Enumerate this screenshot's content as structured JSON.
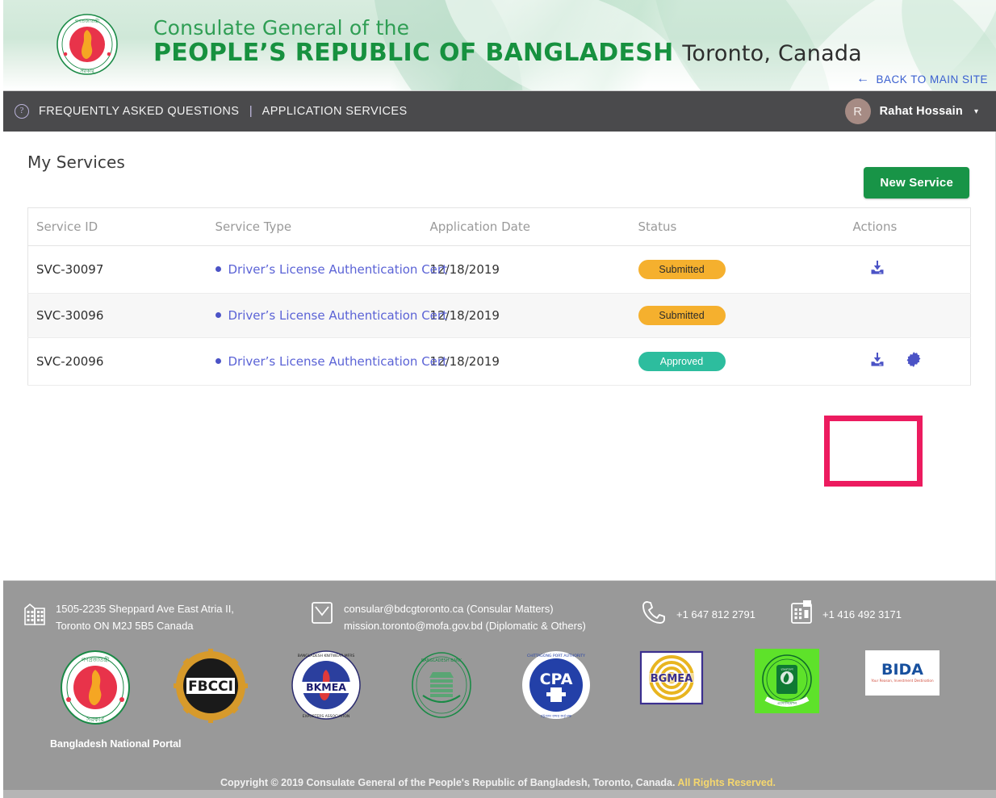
{
  "header": {
    "emblem_alt": "bangladesh-government-emblem",
    "line1": "Consulate General of the",
    "line2": "PEOPLE’S REPUBLIC OF BANGLADESH",
    "city": "Toronto, Canada",
    "back_link": "BACK TO MAIN SITE",
    "back_arrow": "←"
  },
  "nav": {
    "help_icon": "?",
    "faq": "FREQUENTLY ASKED QUESTIONS",
    "separator": "|",
    "application_services": "APPLICATION SERVICES",
    "user_initial": "R",
    "user_name": "Rahat Hossain",
    "caret": "▾"
  },
  "main": {
    "title": "My Services",
    "new_service_button": "New Service",
    "table": {
      "columns": [
        "Service ID",
        "Service Type",
        "Application Date",
        "Status",
        "Actions"
      ],
      "rows": [
        {
          "id": "SVC-30097",
          "type": "Driver’s License Authentication Cert",
          "date": "12/18/2019",
          "status": "Submitted",
          "status_kind": "submitted",
          "actions": [
            "download-icon"
          ]
        },
        {
          "id": "SVC-30096",
          "type": "Driver’s License Authentication Cert",
          "date": "12/18/2019",
          "status": "Submitted",
          "status_kind": "submitted",
          "actions": []
        },
        {
          "id": "SVC-20096",
          "type": "Driver’s License Authentication Cert",
          "date": "12/18/2019",
          "status": "Approved",
          "status_kind": "approved",
          "actions": [
            "download-icon",
            "certificate-seal-icon"
          ]
        }
      ]
    },
    "highlight": {
      "color": "#ec1b5f"
    }
  },
  "footer": {
    "address_line1": "1505-2235 Sheppard Ave East Atria II,",
    "address_line2": "Toronto ON  M2J 5B5 Canada",
    "email_line1": "consular@bdcgtoronto.ca (Consular Matters)",
    "email_line2": "mission.toronto@mofa.gov.bd (Diplomatic & Others)",
    "phone": "+1 647 812 2791",
    "fax": "+1 416 492 3171",
    "logos": [
      {
        "name": "bangladesh-national-portal-logo",
        "caption": "Bangladesh National Portal"
      },
      {
        "name": "fbcci-logo",
        "caption": ""
      },
      {
        "name": "bkmea-logo",
        "caption": ""
      },
      {
        "name": "bangladesh-bank-logo",
        "caption": ""
      },
      {
        "name": "chittagong-port-authority-logo",
        "caption": ""
      },
      {
        "name": "bgmea-logo",
        "caption": ""
      },
      {
        "name": "bangladesh-green-seal-logo",
        "caption": ""
      },
      {
        "name": "bida-logo",
        "caption": ""
      }
    ],
    "logo_text": {
      "fbcci": "FBCCI",
      "bkmea": "BKMEA",
      "cpa": "CPA",
      "bgmea": "BGMEA",
      "bida": "BIDA",
      "bida_sub": "Your Reason, Investment Destination"
    },
    "copyright_main": "Copyright © 2019 Consulate General of the People's Republic of Bangladesh, Toronto, Canada. ",
    "copyright_tail": "All Rights Reserved."
  },
  "colors": {
    "brand_green": "#17913f",
    "nav_bg": "#4a4a4c",
    "accent_blue": "#5b63d6",
    "status_submitted": "#f5b02e",
    "status_approved": "#2dbd9e",
    "highlight_pink": "#ec1b5f",
    "footer_bg": "#999999"
  }
}
